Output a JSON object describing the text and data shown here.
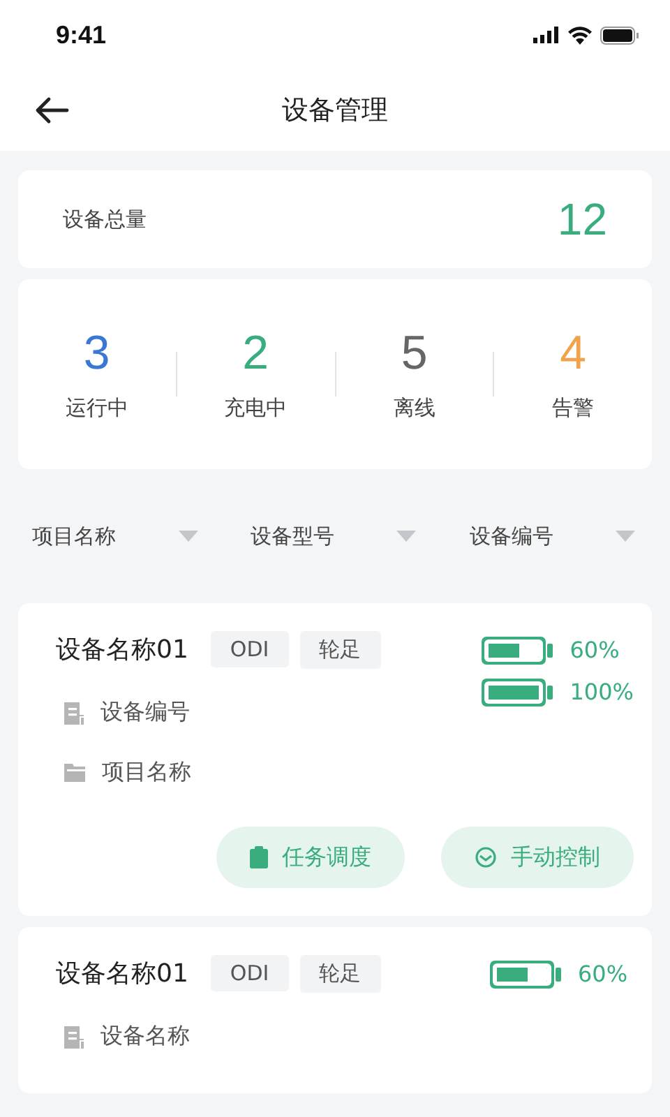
{
  "status_bar": {
    "time": "9:41"
  },
  "header": {
    "title": "设备管理"
  },
  "total": {
    "label": "设备总量",
    "value": "12"
  },
  "stats": [
    {
      "value": "3",
      "label": "运行中",
      "color": "#3b78d6"
    },
    {
      "value": "2",
      "label": "充电中",
      "color": "#3aad7e"
    },
    {
      "value": "5",
      "label": "离线",
      "color": "#666666"
    },
    {
      "value": "4",
      "label": "告警",
      "color": "#f0a24c"
    }
  ],
  "filters": [
    {
      "label": "项目名称"
    },
    {
      "label": "设备型号"
    },
    {
      "label": "设备编号"
    }
  ],
  "devices": [
    {
      "name": "设备名称01",
      "tags": [
        "ODI",
        "轮足"
      ],
      "batteries": [
        {
          "level": 0.6,
          "reading": "60%"
        },
        {
          "level": 1,
          "reading": "100%"
        }
      ],
      "details": [
        {
          "kind": "doc",
          "text": "设备编号"
        },
        {
          "kind": "folder",
          "text": "项目名称"
        }
      ],
      "actions": [
        {
          "kind": "task",
          "label": "任务调度"
        },
        {
          "kind": "wheel",
          "label": "手动控制"
        }
      ]
    },
    {
      "name": "设备名称01",
      "tags": [
        "ODI",
        "轮足"
      ],
      "batteries": [
        {
          "level": 0.6,
          "reading": "60%"
        }
      ],
      "details": [
        {
          "kind": "doc",
          "text": "设备名称"
        }
      ]
    }
  ]
}
